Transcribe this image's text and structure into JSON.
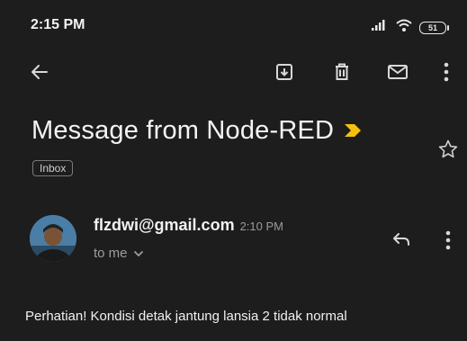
{
  "status_bar": {
    "time": "2:15 PM",
    "battery": "51",
    "icons": [
      "signal-icon",
      "wifi-icon",
      "battery-icon"
    ]
  },
  "toolbar": {
    "icons": [
      "back-arrow-icon",
      "archive-icon",
      "delete-icon",
      "mail-icon",
      "more-vert-icon"
    ]
  },
  "message": {
    "subject": "Message from Node-RED",
    "label": "Inbox",
    "sender": "flzdwi@gmail.com",
    "time": "2:10 PM",
    "recipient": "to me",
    "body": "Perhatian! Kondisi detak jantung lansia 2 tidak normal"
  },
  "colors": {
    "background": "#1d1d1d",
    "importance_marker": "#f4c20d",
    "secondary_text": "#9e9e9e"
  }
}
